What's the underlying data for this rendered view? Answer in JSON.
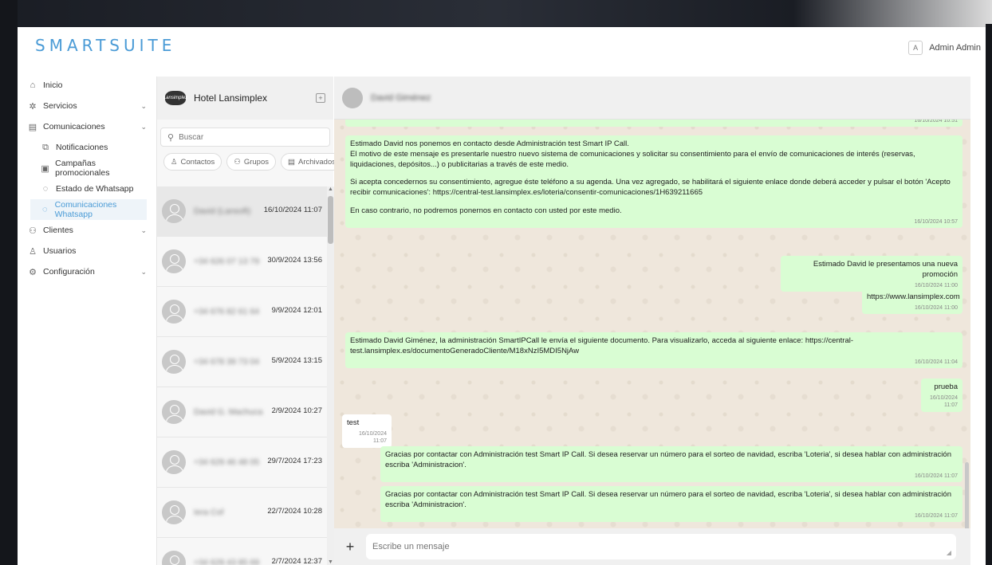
{
  "app": {
    "logo": "SMARTSUITE"
  },
  "user": {
    "initial": "A",
    "name": "Admin Admin"
  },
  "sidebar": {
    "items": [
      {
        "label": "Inicio",
        "icon": "home-icon",
        "glyph": "⌂",
        "chevron": false,
        "level": 0
      },
      {
        "label": "Servicios",
        "icon": "services-icon",
        "glyph": "✲",
        "chevron": true,
        "level": 0
      },
      {
        "label": "Comunicaciones",
        "icon": "message-square-icon",
        "glyph": "▤",
        "chevron": true,
        "level": 0
      },
      {
        "label": "Notificaciones",
        "icon": "notification-icon",
        "glyph": "⧉",
        "chevron": false,
        "level": 1
      },
      {
        "label": "Campañas promocionales",
        "icon": "campaign-icon",
        "glyph": "▣",
        "chevron": false,
        "level": 1
      },
      {
        "label": "Estado de Whatsapp",
        "icon": "whatsapp-icon",
        "glyph": "◌",
        "chevron": false,
        "level": 1
      },
      {
        "label": "Comunicaciones Whatsapp",
        "icon": "whatsapp-icon",
        "glyph": "◌",
        "chevron": false,
        "level": 1,
        "active": true
      },
      {
        "label": "Clientes",
        "icon": "clients-icon",
        "glyph": "⚇",
        "chevron": true,
        "level": 0
      },
      {
        "label": "Usuarios",
        "icon": "user-icon",
        "glyph": "♙",
        "chevron": false,
        "level": 0
      },
      {
        "label": "Configuración",
        "icon": "settings-icon",
        "glyph": "⚙",
        "chevron": true,
        "level": 0
      }
    ]
  },
  "contacts": {
    "hotel_name": "Hotel Lansimplex",
    "hotel_logo_text": "Lansimplex",
    "search_placeholder": "Buscar",
    "filters": [
      {
        "label": "Contactos",
        "icon": "contacts-icon",
        "glyph": "♙"
      },
      {
        "label": "Grupos",
        "icon": "groups-icon",
        "glyph": "⚇"
      },
      {
        "label": "Archivados",
        "icon": "archive-icon",
        "glyph": "▤"
      }
    ],
    "list": [
      {
        "name": "David (Lansoft)",
        "date": "16/10/2024 11:07",
        "selected": true
      },
      {
        "name": "+34 626 07 13 79",
        "date": "30/9/2024 13:56"
      },
      {
        "name": "+34 676 82 61 64",
        "date": "9/9/2024 12:01"
      },
      {
        "name": "+34 678 39 73 04",
        "date": "5/9/2024 13:15"
      },
      {
        "name": "David G. Machuca",
        "date": "2/9/2024 10:27"
      },
      {
        "name": "+34 629 46 48 05",
        "date": "29/7/2024 17:23"
      },
      {
        "name": "Iera Cof",
        "date": "22/7/2024 10:28"
      },
      {
        "name": "+34 629 43 85 69",
        "date": "2/7/2024 12:37"
      }
    ]
  },
  "chat": {
    "contact_name": "David Giménez",
    "messages": [
      {
        "dir": "out",
        "text": "",
        "time": "16/10/2024 10:51"
      },
      {
        "dir": "out",
        "lines": [
          "Estimado David nos ponemos en contacto desde Administración test Smart IP Call.",
          "El motivo de este mensaje es presentarle nuestro nuevo sistema de comunicaciones y solicitar su consentimiento para el envío de comunicaciones de interés (reservas, liquidaciones, depósitos...) o publicitarias a través de este medio.",
          "",
          "Si acepta concedernos su consentimiento, agregue éste teléfono a su agenda. Una vez agregado, se habilitará el siguiente enlace donde deberá acceder y pulsar el botón 'Acepto recibir comunicaciones': https://central-test.lansimplex.es/loteria/consentir-comunicaciones/1H639211665",
          "",
          "En caso contrario, no podremos ponernos en contacto con usted por este medio."
        ],
        "time": "16/10/2024 10:57"
      },
      {
        "dir": "out",
        "text": "Estimado David le presentamos una nueva promoción",
        "time": "16/10/2024 11:00"
      },
      {
        "dir": "out",
        "text": "https://www.lansimplex.com",
        "time": "16/10/2024 11:00"
      },
      {
        "dir": "out",
        "text": "Estimado David Giménez, la administración SmartIPCall le envía el siguiente documento. Para visualizarlo, acceda al siguiente enlace: https://central-test.lansimplex.es/documentoGeneradoCliente/M18xNzI5MDI5NjAw",
        "time": "16/10/2024 11:04"
      },
      {
        "dir": "out",
        "text": "prueba",
        "time": "16/10/2024 11:07"
      },
      {
        "dir": "in",
        "text": "test",
        "time": "16/10/2024 11:07"
      },
      {
        "dir": "out",
        "text": "Gracias por contactar con Administración test Smart IP Call. Si desea reservar un número para el sorteo de navidad, escriba 'Loteria', si desea hablar con administración escriba 'Administracion'.",
        "time": "16/10/2024 11:07"
      },
      {
        "dir": "out",
        "text": "Gracias por contactar con Administración test Smart IP Call. Si desea reservar un número para el sorteo de navidad, escriba 'Loteria', si desea hablar con administración escriba 'Administracion'.",
        "time": "16/10/2024 11:07"
      }
    ],
    "composer_placeholder": "Escribe un mensaje"
  },
  "colors": {
    "accent": "#4a9bd6",
    "outgoing_bubble": "#d9fdd3",
    "chat_bg": "#efe7dc"
  }
}
